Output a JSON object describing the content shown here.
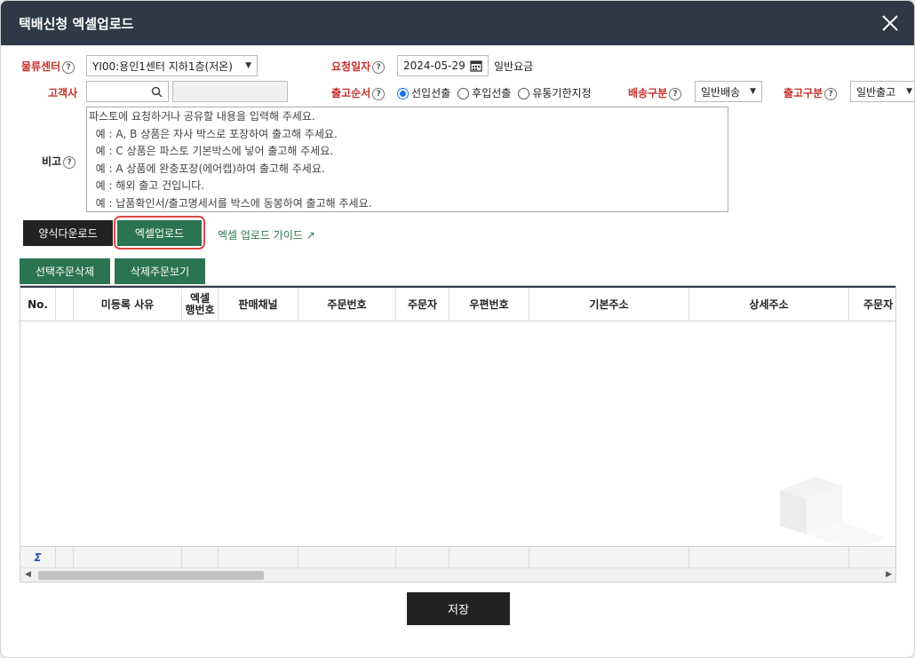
{
  "window": {
    "title": "택배신청 엑셀업로드"
  },
  "form": {
    "center_label": "물류센터",
    "center_value": "YI00:용인1센터 지하1층(저온)",
    "request_date_label": "요청일자",
    "request_date_value": "2024-05-29",
    "rate_text": "일반요금",
    "customer_label": "고객사",
    "customer_value": "",
    "customer_name_value": "",
    "shipping_order_label": "출고순서",
    "shipping_order_options": [
      "선입선출",
      "후입선출",
      "유통기한지정"
    ],
    "shipping_order_selected": "선입선출",
    "delivery_type_label": "배송구분",
    "delivery_type_value": "일반배송",
    "outbound_type_label": "출고구분",
    "outbound_type_value": "일반출고",
    "remarks_label": "비고",
    "remarks_placeholder": "파스토에 요청하거나 공유할 내용을 입력해 주세요.\n  예 : A, B 상품은 자사 박스로 포장하여 출고해 주세요.\n  예 : C 상품은 파스토 기본박스에 넣어 출고해 주세요.\n  예 : A 상품에 완충포장(에어캡)하여 출고해 주세요.\n  예 : 해외 출고 건입니다.\n  예 : 납품확인서/출고명세서를 박스에 동봉하여 출고해 주세요."
  },
  "actions": {
    "template_download": "양식다운로드",
    "excel_upload": "엑셀업로드",
    "upload_guide": "엑셀 업로드 가이드 ↗",
    "delete_selected": "선택주문삭제",
    "view_deleted": "삭제주문보기",
    "save": "저장"
  },
  "grid": {
    "columns": [
      "No.",
      "",
      "미등록 사유",
      "엑셀\n행번호",
      "판매채널",
      "주문번호",
      "주문자",
      "우편번호",
      "기본주소",
      "상세주소",
      "주문자 주"
    ],
    "sum_symbol": "Σ"
  },
  "colors": {
    "header_bg": "#2e3846",
    "accent_green": "#2b7451",
    "required_red": "#c4302b",
    "highlight": "#e0483e"
  }
}
